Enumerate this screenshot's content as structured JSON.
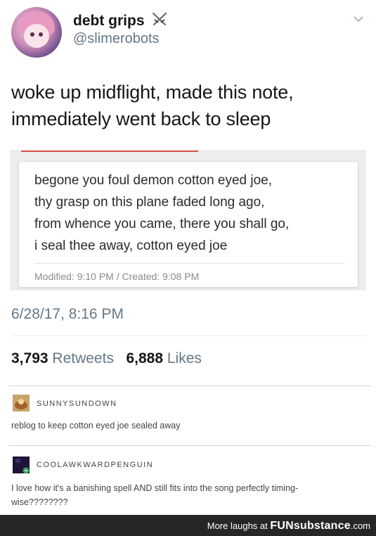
{
  "tweet": {
    "display_name": "debt grips",
    "handle": "@slimerobots",
    "text_line1": "woke up midflight, made this note,",
    "text_line2": "immediately went back to sleep",
    "timestamp": "6/28/17, 8:16 PM",
    "retweets_count": "3,793",
    "retweets_label": "Retweets",
    "likes_count": "6,888",
    "likes_label": "Likes"
  },
  "note": {
    "lines": [
      "begone you foul demon cotton eyed joe,",
      "thy grasp on this plane faded long ago,",
      "from whence you came, there you shall go,",
      "i seal thee away, cotton eyed joe"
    ],
    "meta": "Modified: 9:10 PM / Created: 9:08 PM"
  },
  "reblogs": [
    {
      "username": "SUNNYSUNDOWN",
      "text": "reblog to keep cotton eyed joe sealed away"
    },
    {
      "username": "COOLAWKWARDPENGUIN",
      "text_line1": "I love how it's a banishing spell AND still fits into the song perfectly timing-",
      "text_line2": "wise????????"
    }
  ],
  "footer": {
    "prefix": "More laughs at",
    "logo_bold": "FUN",
    "logo_rest": "substance",
    "logo_suffix": ".com"
  },
  "colors": {
    "twitter_gray": "#657786",
    "text_dark": "#14171a",
    "note_accent": "#d9534f",
    "footer_bg": "#262626"
  },
  "icons": {
    "header_emoji": "crossed-swords-icon",
    "menu": "chevron-down-icon"
  }
}
